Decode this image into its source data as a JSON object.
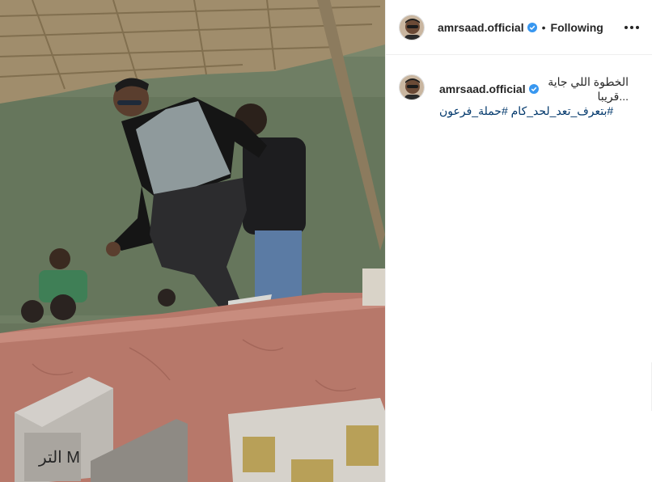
{
  "post": {
    "photo": {
      "case_lettering": "التر M"
    }
  },
  "header": {
    "username": "amrsaad.official",
    "separator": "•",
    "follow_status": "Following",
    "more_icon": "more-horizontal-icon",
    "verified_icon": "verified-badge-icon",
    "verified_color": "#3897f0"
  },
  "caption": {
    "username": "amrsaad.official",
    "text": "الخطوة اللي جاية ...قريبا",
    "hashtags": [
      "#بتعرف_تعد_لحد_كام",
      "#حملة_فرعون"
    ]
  },
  "colors": {
    "link": "#00376b",
    "text": "#262626",
    "border": "#efefef"
  }
}
